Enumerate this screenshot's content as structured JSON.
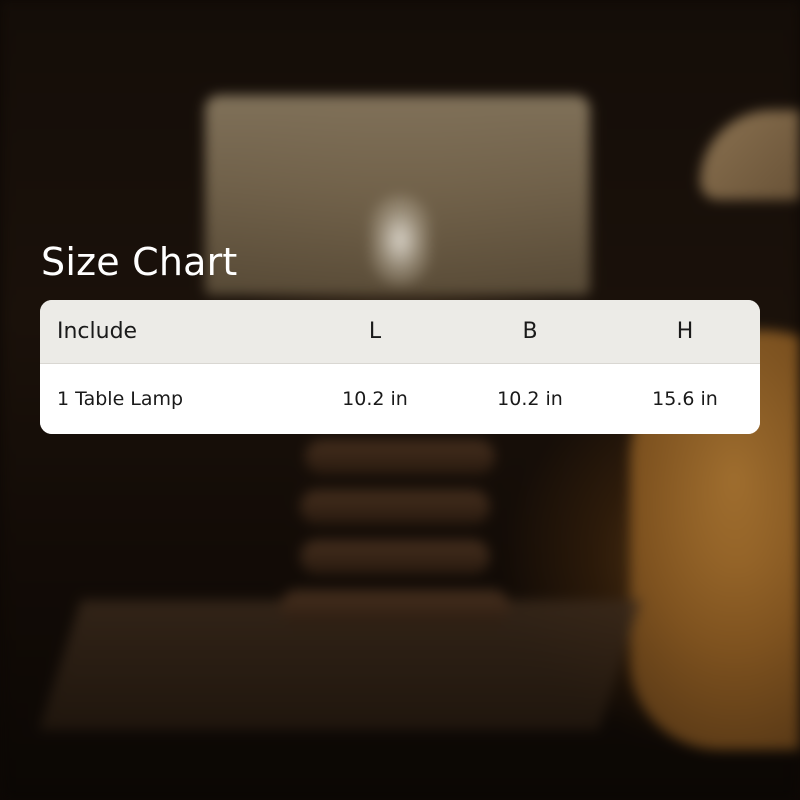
{
  "size_chart": {
    "title": "Size Chart",
    "headers": [
      "Include",
      "L",
      "B",
      "H"
    ],
    "rows": [
      [
        "1 Table Lamp",
        "10.2 in",
        "10.2 in",
        "15.6 in"
      ]
    ]
  }
}
